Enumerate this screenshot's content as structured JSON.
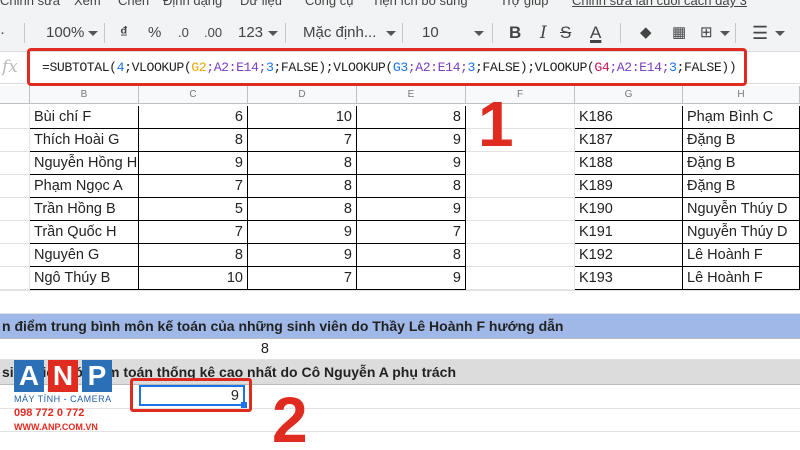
{
  "menu": {
    "items": [
      "Chỉnh sửa",
      "Xem",
      "Chèn",
      "Định dạng",
      "Dữ liệu",
      "Công cụ",
      "Tiện ích bổ sung",
      "Trợ giúp",
      "Chỉnh sửa lần cuối cách đây 3"
    ]
  },
  "toolbar": {
    "zoom": "100%",
    "currency": "₫",
    "percent": "%",
    "decrease_decimal": ".0",
    "increase_decimal": ".00",
    "more_formats": "123",
    "font": "Mặc định...",
    "font_size": "10",
    "bold": "B",
    "italic": "I",
    "strike": "S",
    "text_color": "A",
    "text_color_hex": "#000000"
  },
  "formula_bar": {
    "fx": "fx",
    "formula_parts": [
      {
        "text": "=SUBTOTAL(",
        "color": "#222222"
      },
      {
        "text": "4",
        "color": "#1a73e8"
      },
      {
        "text": ";VLOOKUP(",
        "color": "#222222"
      },
      {
        "text": "G2",
        "color": "#e8a600"
      },
      {
        "text": ";A2:E14;",
        "color": "#7b3fbf"
      },
      {
        "text": "3",
        "color": "#1a73e8"
      },
      {
        "text": ";FALSE);VLOOKUP(",
        "color": "#222222"
      },
      {
        "text": "G3",
        "color": "#1a73e8"
      },
      {
        "text": ";A2:E14;",
        "color": "#7b3fbf"
      },
      {
        "text": "3",
        "color": "#1a73e8"
      },
      {
        "text": ";FALSE);VLOOKUP(",
        "color": "#222222"
      },
      {
        "text": "G4",
        "color": "#c2185b"
      },
      {
        "text": ";A2:E14;",
        "color": "#7b3fbf"
      },
      {
        "text": "3",
        "color": "#1a73e8"
      },
      {
        "text": ";FALSE))",
        "color": "#222222"
      }
    ]
  },
  "columns": [
    "B",
    "C",
    "D",
    "E",
    "F",
    "G",
    "H"
  ],
  "rows": [
    {
      "name": "Bùi chí F",
      "c": "6",
      "d": "10",
      "e": "8",
      "g": "K186",
      "h": "Phạm Bình C"
    },
    {
      "name": "Thích Hoài G",
      "c": "8",
      "d": "7",
      "e": "9",
      "g": "K187",
      "h": "Đặng B"
    },
    {
      "name": "Nguyễn Hồng H",
      "c": "9",
      "d": "8",
      "e": "9",
      "g": "K188",
      "h": "Đặng B"
    },
    {
      "name": "Phạm Ngọc A",
      "c": "7",
      "d": "8",
      "e": "8",
      "g": "K189",
      "h": "Đặng B"
    },
    {
      "name": "Trần Hồng B",
      "c": "5",
      "d": "8",
      "e": "9",
      "g": "K190",
      "h": "Nguyễn Thúy D"
    },
    {
      "name": "Trần Quốc H",
      "c": "7",
      "d": "9",
      "e": "7",
      "g": "K191",
      "h": "Nguyễn Thúy D"
    },
    {
      "name": "Nguyên G",
      "c": "8",
      "d": "9",
      "e": "8",
      "g": "K192",
      "h": "Lê Hoành F"
    },
    {
      "name": "Ngô Thúy B",
      "c": "10",
      "d": "7",
      "e": "9",
      "g": "K193",
      "h": "Lê Hoành F"
    }
  ],
  "band1": {
    "text": "n điểm trung bình môn kế toán của những sinh viên do Thầy Lê Hoành F hướng dẫn",
    "color": "#9fb8e8"
  },
  "band2": {
    "text": "sinh viên có điểm toán thống kê cao nhất do Cô Nguyễn A phụ trách",
    "color": "#dcdcdc"
  },
  "result1": "8",
  "result2": "9",
  "steps": {
    "one": "1",
    "two": "2"
  },
  "logo": {
    "a": "A",
    "n": "N",
    "p": "P",
    "tagline": "MÁY TÍNH - CAMERA",
    "phone": "098 772 0 772",
    "website": "WWW.ANP.COM.VN"
  },
  "colors": {
    "highlight_red": "#e02b20",
    "selection_blue": "#1a73e8"
  }
}
